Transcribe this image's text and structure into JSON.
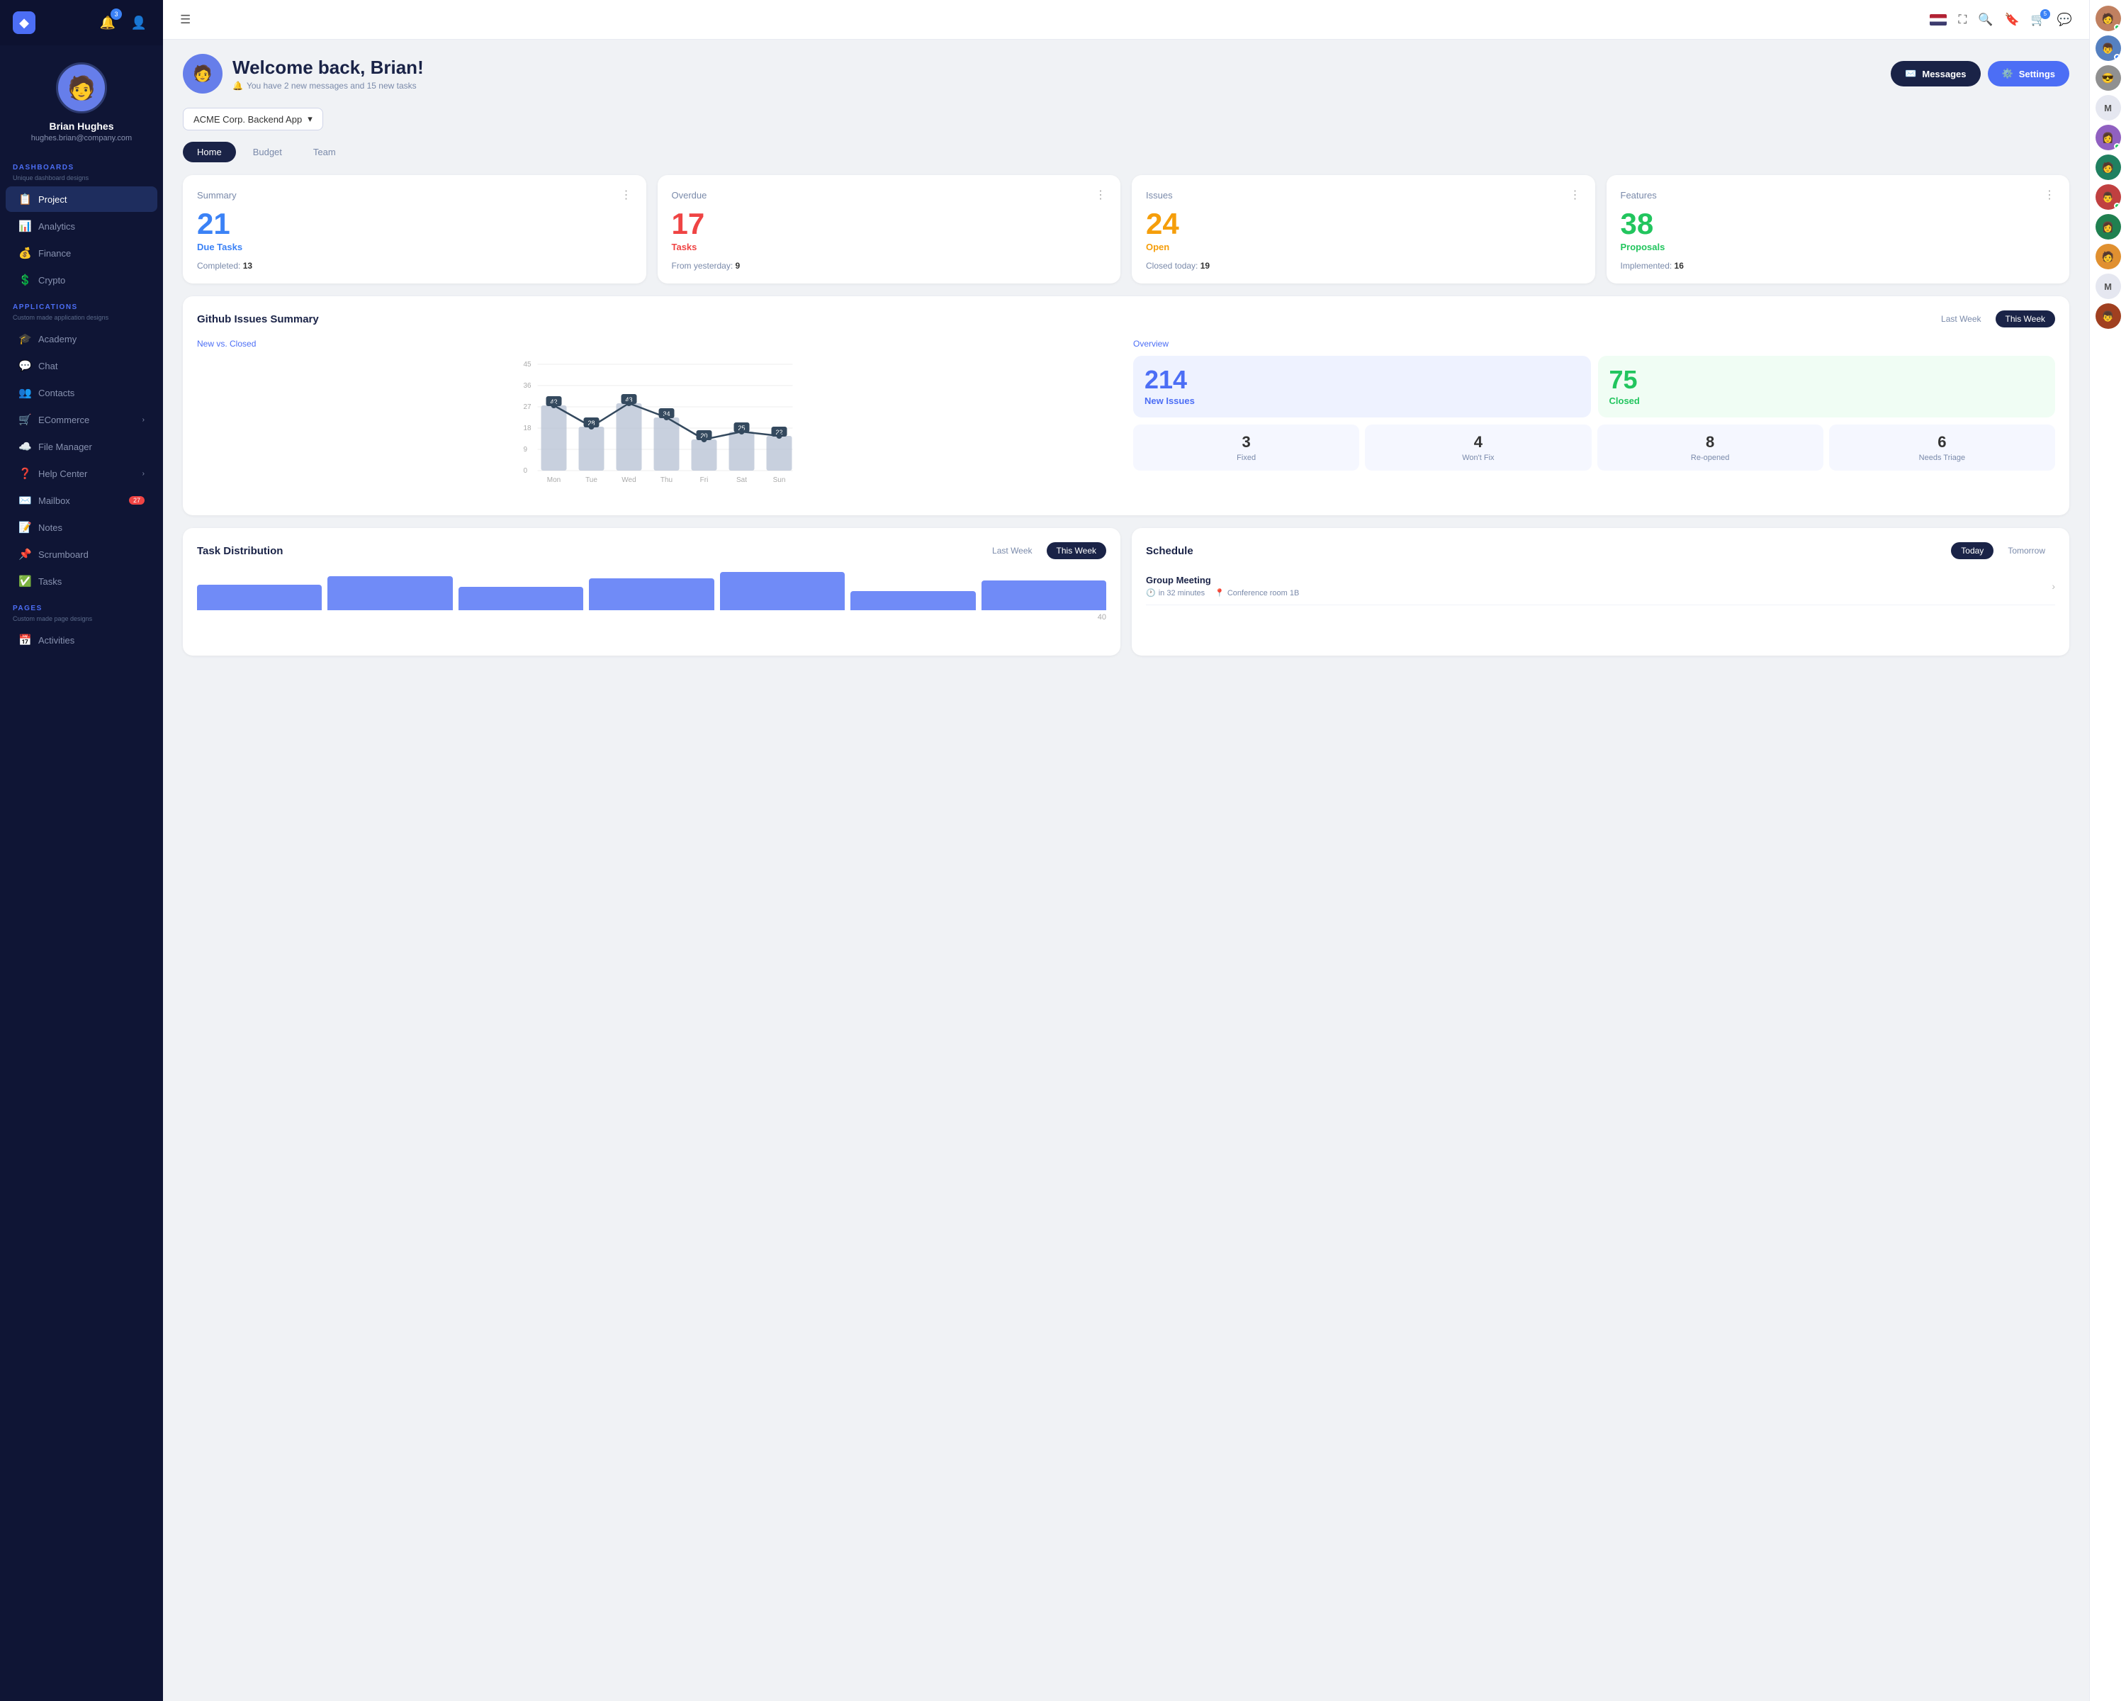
{
  "sidebar": {
    "logo": "◆",
    "notification_badge": "3",
    "profile": {
      "name": "Brian Hughes",
      "email": "hughes.brian@company.com"
    },
    "dashboards": {
      "label": "DASHBOARDS",
      "sub": "Unique dashboard designs",
      "items": [
        {
          "id": "project",
          "icon": "📋",
          "label": "Project",
          "active": true
        },
        {
          "id": "analytics",
          "icon": "📊",
          "label": "Analytics"
        },
        {
          "id": "finance",
          "icon": "💰",
          "label": "Finance"
        },
        {
          "id": "crypto",
          "icon": "💲",
          "label": "Crypto"
        }
      ]
    },
    "applications": {
      "label": "APPLICATIONS",
      "sub": "Custom made application designs",
      "items": [
        {
          "id": "academy",
          "icon": "🎓",
          "label": "Academy"
        },
        {
          "id": "chat",
          "icon": "💬",
          "label": "Chat"
        },
        {
          "id": "contacts",
          "icon": "👥",
          "label": "Contacts"
        },
        {
          "id": "ecommerce",
          "icon": "🛒",
          "label": "ECommerce",
          "chevron": true
        },
        {
          "id": "filemanager",
          "icon": "☁️",
          "label": "File Manager"
        },
        {
          "id": "helpcenter",
          "icon": "❓",
          "label": "Help Center",
          "chevron": true
        },
        {
          "id": "mailbox",
          "icon": "✉️",
          "label": "Mailbox",
          "badge": "27"
        },
        {
          "id": "notes",
          "icon": "📝",
          "label": "Notes"
        },
        {
          "id": "scrumboard",
          "icon": "📌",
          "label": "Scrumboard"
        },
        {
          "id": "tasks",
          "icon": "✅",
          "label": "Tasks"
        }
      ]
    },
    "pages": {
      "label": "PAGES",
      "sub": "Custom made page designs",
      "items": [
        {
          "id": "activities",
          "icon": "📅",
          "label": "Activities"
        }
      ]
    }
  },
  "topbar": {
    "messages_badge": "5"
  },
  "welcome": {
    "title": "Welcome back, Brian!",
    "subtitle": "You have 2 new messages and 15 new tasks",
    "messages_btn": "Messages",
    "settings_btn": "Settings"
  },
  "project_selector": {
    "label": "ACME Corp. Backend App"
  },
  "tabs": [
    {
      "id": "home",
      "label": "Home",
      "active": true
    },
    {
      "id": "budget",
      "label": "Budget"
    },
    {
      "id": "team",
      "label": "Team"
    }
  ],
  "stats": [
    {
      "id": "summary",
      "title": "Summary",
      "number": "21",
      "number_color": "blue",
      "label": "Due Tasks",
      "label_color": "blue",
      "sub_key": "Completed:",
      "sub_val": "13"
    },
    {
      "id": "overdue",
      "title": "Overdue",
      "number": "17",
      "number_color": "red",
      "label": "Tasks",
      "label_color": "red",
      "sub_key": "From yesterday:",
      "sub_val": "9"
    },
    {
      "id": "issues",
      "title": "Issues",
      "number": "24",
      "number_color": "orange",
      "label": "Open",
      "label_color": "orange",
      "sub_key": "Closed today:",
      "sub_val": "19"
    },
    {
      "id": "features",
      "title": "Features",
      "number": "38",
      "number_color": "green",
      "label": "Proposals",
      "label_color": "green",
      "sub_key": "Implemented:",
      "sub_val": "16"
    }
  ],
  "github": {
    "title": "Github Issues Summary",
    "last_week_btn": "Last Week",
    "this_week_btn": "This Week",
    "chart": {
      "subtitle": "New vs. Closed",
      "y_labels": [
        "45",
        "36",
        "27",
        "18",
        "9",
        "0"
      ],
      "x_labels": [
        "Mon",
        "Tue",
        "Wed",
        "Thu",
        "Fri",
        "Sat",
        "Sun"
      ],
      "line_points": [
        {
          "x": "Mon",
          "val": 42
        },
        {
          "x": "Tue",
          "val": 28
        },
        {
          "x": "Wed",
          "val": 43
        },
        {
          "x": "Thu",
          "val": 34
        },
        {
          "x": "Fri",
          "val": 20
        },
        {
          "x": "Sat",
          "val": 25
        },
        {
          "x": "Sun",
          "val": 22
        }
      ],
      "bar_values": [
        42,
        28,
        43,
        34,
        20,
        25,
        22
      ]
    },
    "overview": {
      "subtitle": "Overview",
      "new_issues_num": "214",
      "new_issues_lbl": "New Issues",
      "closed_num": "75",
      "closed_lbl": "Closed",
      "mini_stats": [
        {
          "num": "3",
          "lbl": "Fixed"
        },
        {
          "num": "4",
          "lbl": "Won't Fix"
        },
        {
          "num": "8",
          "lbl": "Re-opened"
        },
        {
          "num": "6",
          "lbl": "Needs Triage"
        }
      ]
    }
  },
  "task_distribution": {
    "title": "Task Distribution",
    "last_week_btn": "Last Week",
    "this_week_btn": "This Week",
    "bar_heights": [
      60,
      80,
      55,
      75,
      90,
      45,
      70
    ]
  },
  "schedule": {
    "title": "Schedule",
    "today_btn": "Today",
    "tomorrow_btn": "Tomorrow",
    "items": [
      {
        "name": "Group Meeting",
        "time": "in 32 minutes",
        "location": "Conference room 1B"
      }
    ]
  },
  "right_panel": {
    "avatars": [
      {
        "type": "img",
        "initials": "B",
        "color": "#c08060",
        "dot": "green"
      },
      {
        "type": "img",
        "initials": "A",
        "color": "#5580c0",
        "dot": "blue"
      },
      {
        "type": "img",
        "initials": "C",
        "color": "#808080",
        "dot": null
      },
      {
        "type": "letter",
        "letter": "M",
        "color": "#e5e7f0"
      },
      {
        "type": "img",
        "initials": "D",
        "color": "#9060c0",
        "dot": "green"
      },
      {
        "type": "img",
        "initials": "E",
        "color": "#40a080",
        "dot": null
      },
      {
        "type": "img",
        "initials": "F",
        "color": "#c04040",
        "dot": "green"
      },
      {
        "type": "img",
        "initials": "G",
        "color": "#208050",
        "dot": null
      },
      {
        "type": "img",
        "initials": "H",
        "color": "#e09030",
        "dot": null
      },
      {
        "type": "letter",
        "letter": "M",
        "color": "#e5e7f0"
      },
      {
        "type": "img",
        "initials": "I",
        "color": "#a04020",
        "dot": null
      }
    ]
  }
}
